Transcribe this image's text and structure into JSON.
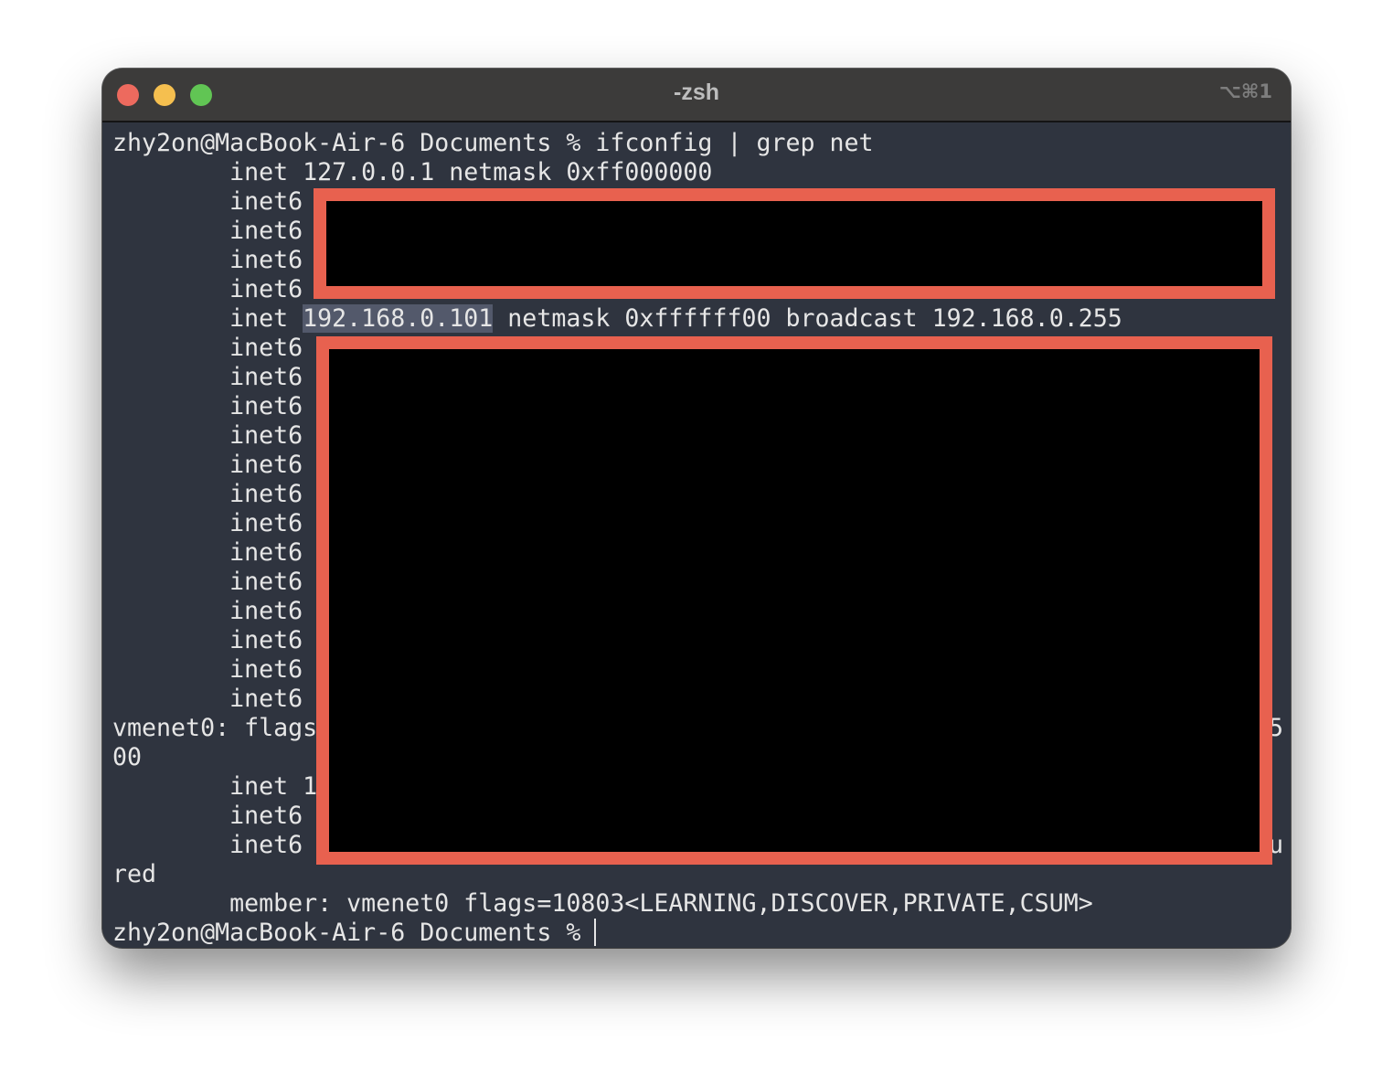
{
  "window": {
    "title": "-zsh",
    "shortcut": "⌥⌘1",
    "traffic_lights": [
      {
        "name": "close",
        "color": "#ed6a5e"
      },
      {
        "name": "minimize",
        "color": "#f5bf4f"
      },
      {
        "name": "zoom",
        "color": "#61c554"
      }
    ]
  },
  "terminal": {
    "background": "#2f343f",
    "foreground": "#e6e6e6",
    "lines": [
      "zhy2on@MacBook-Air-6 Documents % ifconfig | grep net",
      "        inet 127.0.0.1 netmask 0xff000000",
      "        inet6",
      "        inet6",
      "        inet6",
      "        inet6",
      "        inet 192.168.0.101 netmask 0xffffff00 broadcast 192.168.0.255",
      "        inet6",
      "        inet6",
      "        inet6",
      "        inet6",
      "        inet6",
      "        inet6",
      "        inet6",
      "        inet6",
      "        inet6",
      "        inet6",
      "        inet6",
      "        inet6",
      "        inet6",
      "vmenet0: flags",
      "00",
      "        inet 1",
      "        inet6",
      "        inet6",
      "red",
      "        member: vmenet0 flags=10803<LEARNING,DISCOVER,PRIVATE,CSUM>",
      "zhy2on@MacBook-Air-6 Documents % "
    ],
    "highlighted_line": {
      "before": "        inet ",
      "selected": "192.168.0.101",
      "after": " netmask 0xffffff00 broadcast 192.168.0.255"
    },
    "right_edge_fragments": {
      "vmenet_line": "5",
      "inet6_line": "u"
    }
  },
  "redaction": {
    "fill": "#000000",
    "border": "#e8614f"
  }
}
